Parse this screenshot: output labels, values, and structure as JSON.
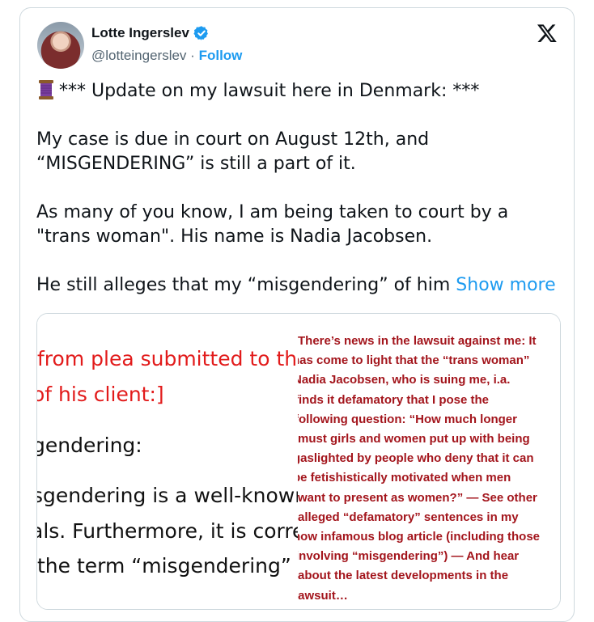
{
  "author": {
    "name": "Lotte Ingerslev",
    "handle": "@lotteingerslev",
    "separator": "·",
    "follow_label": "Follow",
    "verified_color": "#1d9bf0"
  },
  "tweet": {
    "line1": "*** Update on my lawsuit here in Denmark: ***",
    "para2_line1": "My case is due in court on August 12th, and",
    "para2_line2": "“MISGENDERING” is still a part of it.",
    "para3_line1": "As many of you know, I am being taken to court by a",
    "para3_line2": "\"trans woman\". His name is Nadia Jacobsen.",
    "para4": "He still alleges that my “misgendering” of him",
    "show_more": "Show more"
  },
  "media": {
    "doc_lines": [
      "from plea submitted to the",
      "of his client:]",
      "gendering:",
      "sgendering is a well-known",
      "als. Furthermore, it is corre",
      "the term “misgendering” i"
    ],
    "blog_lines": [
      "There’s news in the lawsuit against me: It",
      "has come to light that the “trans woman”",
      "Nadia Jacobsen, who is suing me, i.a.",
      "finds it defamatory that I pose the",
      "following question: “How much longer",
      "must girls and women put up with being",
      "gaslighted by people who deny that it can",
      "be fetishistically motivated when men",
      "want to present as women?” — See other",
      "alleged “defamatory” sentences in my",
      "now infamous blog article (including those",
      "involving “misgendering”) — And hear",
      "about the latest developments in the",
      "lawsuit…"
    ]
  },
  "icons": {
    "avatar": "profile-photo",
    "verified": "verified-badge-icon",
    "x_logo": "x-logo-icon",
    "thread": "thread-spool-icon"
  },
  "colors": {
    "text": "#0f1419",
    "secondary": "#536471",
    "link": "#1d9bf0",
    "doc_red": "#e21b1b",
    "blog_red": "#a3151c"
  }
}
